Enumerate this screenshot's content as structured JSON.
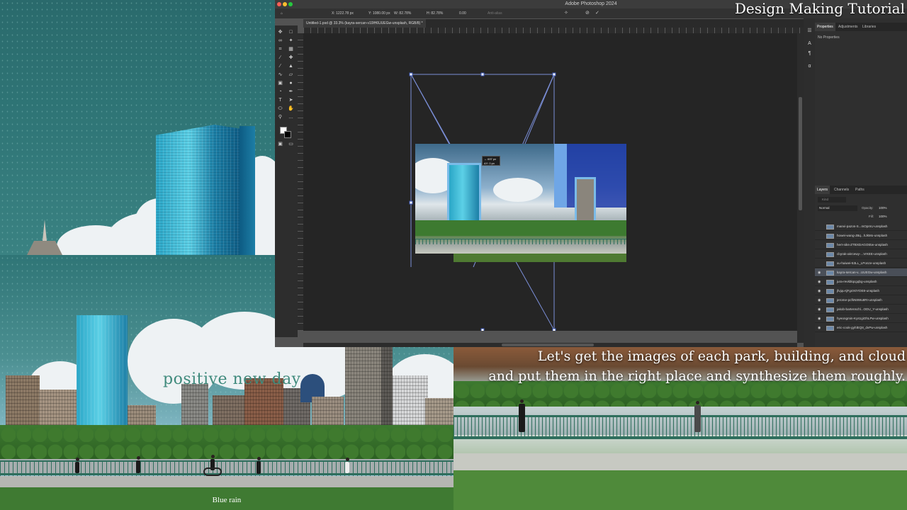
{
  "app": {
    "title": "Adobe Photoshop 2024",
    "document_tab": "Untitled-1.psd @ 33.3% (kayra-sercan-v10lH6UUEGw-unsplash, RGB/8) *",
    "options": {
      "x": "X: 1222.78 px",
      "y": "Y: 1080.00 px",
      "w": "W: 82.78%",
      "h": "H: 82.78%",
      "angle": "0.00",
      "anti_alias": "Anti-alias"
    },
    "transform_tooltip": {
      "line1": "↔ 697 px",
      "line2": "ΔY: 0 px"
    },
    "right_panel": {
      "tabs": [
        "Properties",
        "Adjustments",
        "Libraries"
      ],
      "no_properties": "No Properties"
    },
    "layers_panel": {
      "tabs": [
        "Layers",
        "Channels",
        "Paths"
      ],
      "blend_mode": "Normal",
      "opacity_label": "Opacity:",
      "opacity_value": "100%",
      "fill_label": "Fill:",
      "fill_value": "100%",
      "search_placeholder": "Kind",
      "layers": [
        {
          "name": "manvi-pazos-S...mOpmU-unsplash",
          "visible": false
        },
        {
          "name": "howei-wang-JBq...hJkMo-unsplash",
          "visible": false
        },
        {
          "name": "hert-niks-ZTBXDAGOtEw-unsplash",
          "visible": false
        },
        {
          "name": "cbyrak-akrcewy-...VrKEE-unsplash",
          "visible": false
        },
        {
          "name": "xu-haiwei-53LL_LPonze-unsplash",
          "visible": false
        },
        {
          "name": "kayra-sercan-v...UUEGw-unsplash",
          "visible": true
        },
        {
          "name": "jura-revkblqcgqbg-unsplash",
          "visible": true
        },
        {
          "name": "jfvjqu-tjFg4X0YDE8-unsplash",
          "visible": true
        },
        {
          "name": "jerome-pcfkN8Wu8RI-unsplash",
          "visible": true
        },
        {
          "name": "jakob-bartenschl...ODU_Y-unsplash",
          "visible": true
        },
        {
          "name": "hyeongmin-Kys1giOhLPw-unsplash",
          "visible": true
        },
        {
          "name": "eric-cook-gyhlEQ8_dvPw-unsplash",
          "visible": true
        }
      ]
    }
  },
  "overlay": {
    "tutorial_title": "Design Making Tutorial",
    "positive_text": "positive new day",
    "caption_bottom_left": "Blue rain",
    "caption_line1": "Let's get the images of each park, building, and cloud",
    "caption_line2": "and put them in the right place and synthesize them roughly."
  },
  "colors": {
    "sky_teal": "#2f7576",
    "glass_blue": "#3fb9d8",
    "ps_bg": "#535353",
    "ps_canvas": "#252525",
    "selection_blue": "#6f8fd6",
    "text_teal": "#3f8a7c"
  },
  "icons": [
    "move-icon",
    "marquee-icon",
    "lasso-icon",
    "crop-icon",
    "eyedropper-icon",
    "brush-icon",
    "stamp-icon",
    "eraser-icon",
    "gradient-icon",
    "pen-icon",
    "type-icon",
    "shape-icon",
    "hand-icon",
    "zoom-icon"
  ]
}
